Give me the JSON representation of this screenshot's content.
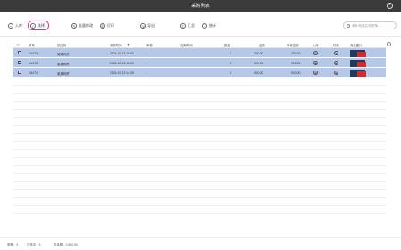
{
  "window": {
    "title": "采购列表"
  },
  "toolbar": {
    "buttons": [
      {
        "label": "入库",
        "icon": "+"
      },
      {
        "label": "选择",
        "icon": "✓"
      },
      {
        "label": "批量修改",
        "icon": "✎"
      },
      {
        "label": "打印",
        "icon": "⎙"
      },
      {
        "label": "导出",
        "icon": "⇲"
      },
      {
        "label": "汇总",
        "icon": "Σ"
      },
      {
        "label": "统计",
        "icon": "◔"
      }
    ],
    "search_placeholder": "单号/商品名/供货单..."
  },
  "table": {
    "headers": [
      "单号",
      "供应商",
      "采购时间",
      "审核",
      "交期时间",
      "数量",
      "金额",
      "单号金额",
      "入库",
      "付款",
      "商品图片"
    ],
    "rows": [
      {
        "id": "D4473",
        "supplier": "某某商贸",
        "time": "2024-10-13 16:00",
        "audit": "-",
        "delivery": "",
        "qty": "2",
        "amount": "700.00",
        "order_amount": "700.00"
      },
      {
        "id": "D4475",
        "supplier": "某某商贸",
        "time": "2024-10-13 16:00",
        "audit": "-",
        "delivery": "",
        "qty": "3",
        "amount": "900.00",
        "order_amount": "900.00"
      },
      {
        "id": "D4474",
        "supplier": "某某商贸",
        "time": "2024-10-13 14:39",
        "audit": "-",
        "delivery": "",
        "qty": "3",
        "amount": "900.00",
        "order_amount": "900.00"
      }
    ]
  },
  "footer": {
    "count_label": "条数：3",
    "selected_label": "已选中：3",
    "amount_label": "总金额：2,500.00"
  }
}
